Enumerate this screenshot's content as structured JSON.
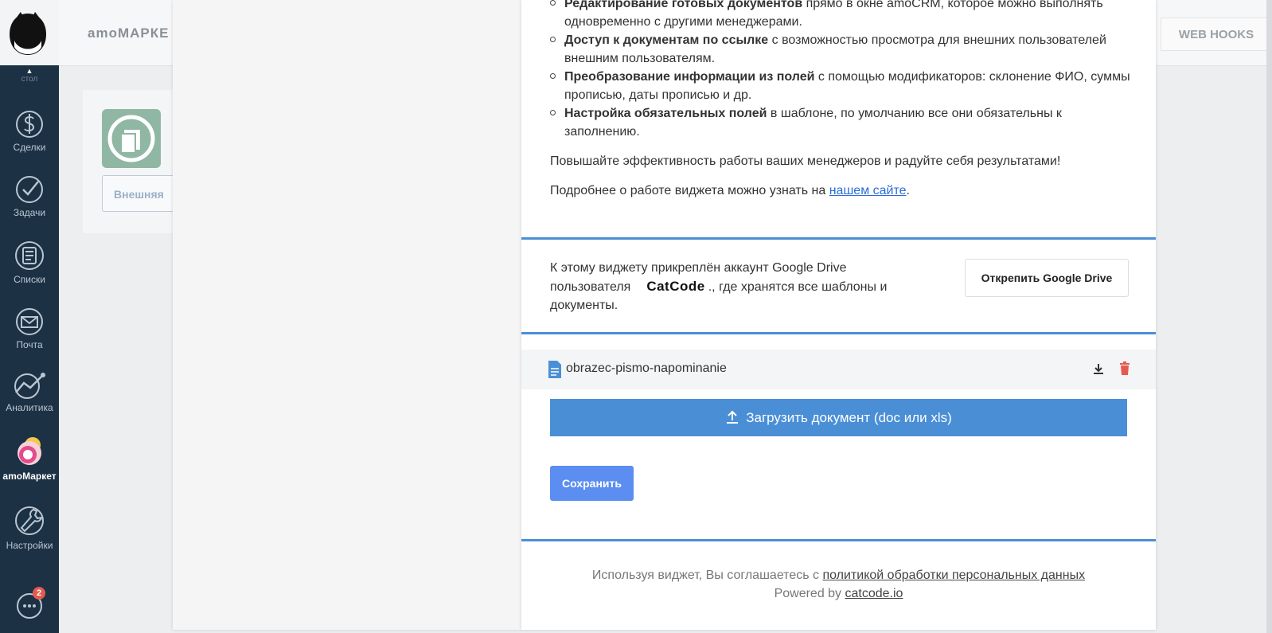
{
  "sidebar": {
    "partial_label": "стол",
    "items": [
      {
        "label": "Сделки",
        "icon": "dollar-icon"
      },
      {
        "label": "Задачи",
        "icon": "check-icon"
      },
      {
        "label": "Списки",
        "icon": "list-icon"
      },
      {
        "label": "Почта",
        "icon": "mail-icon"
      },
      {
        "label": "Аналитика",
        "icon": "analytics-icon"
      },
      {
        "label": "amoМаркет",
        "icon": "market-icon"
      },
      {
        "label": "Настройки",
        "icon": "wrench-icon"
      }
    ],
    "chat_badge": "2"
  },
  "topbar": {
    "title": "amoМАРКЕ",
    "webhooks_label": "WEB HOOKS"
  },
  "card": {
    "button_label": "Внешняя"
  },
  "modal": {
    "features": [
      {
        "bold": "Редактирование готовых документов",
        "rest": " прямо в окне amoCRM, которое можно выполнять одновременно с другими менеджерами."
      },
      {
        "bold": "Доступ к документам по ссылке",
        "rest": " с возможностью просмотра для внешних пользователей внешним пользователям."
      },
      {
        "bold": "Преобразование информации из полей",
        "rest": " с помощью модификаторов: склонение ФИО, суммы прописью, даты прописью и др."
      },
      {
        "bold": "Настройка обязательных полей",
        "rest": " в шаблоне, по умолчанию все они обязательны к заполнению."
      }
    ],
    "efficiency_text": "Повышайте эффективность работы ваших менеджеров и радуйте себя результатами!",
    "more_prefix": "Подробнее о работе виджета можно узнать на ",
    "more_link": "нашем сайте",
    "more_suffix": ".",
    "account_line1": "К этому виджету прикреплён аккаунт Google Drive",
    "account_line2_prefix": "пользователя",
    "account_user": "CatCode",
    "account_line2_suffix": "., где хранятся все шаблоны и",
    "account_line3": "документы.",
    "unpin_label": "Открепить Google Drive",
    "file_name": "obrazec-pismo-napominanie",
    "upload_label": "Загрузить документ (doc или xls)",
    "save_label": "Сохранить",
    "footer_prefix": "Используя виджет, Вы соглашаетесь с ",
    "footer_link": "политикой обработки персональных данных",
    "powered_prefix": "Powered by ",
    "powered_link": "catcode.io"
  },
  "colors": {
    "sidebar_bg": "#1c3144",
    "accent_blue": "#4a8fd6",
    "save_blue": "#5b8ef0",
    "delete_red": "#e55a4e"
  }
}
